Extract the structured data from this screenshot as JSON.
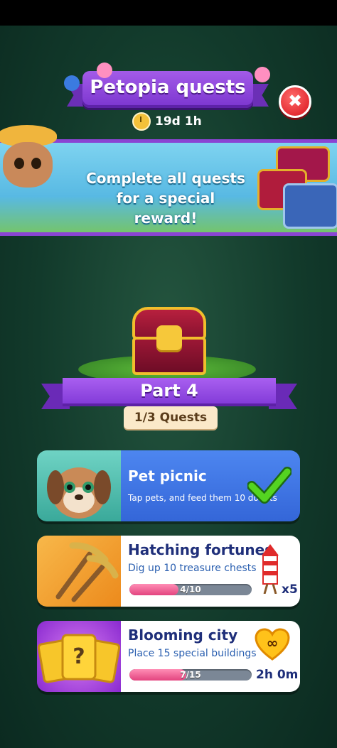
{
  "header": {
    "title": "Petopia quests",
    "timer": "19d 1h",
    "close_label": "✖"
  },
  "banner": {
    "text": "Complete all quests for a special reward!"
  },
  "part": {
    "label": "Part 4",
    "quest_count": "1/3 Quests"
  },
  "quests": [
    {
      "title": "Pet picnic",
      "description": "Tap pets, and feed them 10 donuts",
      "completed": true
    },
    {
      "title": "Hatching fortunes",
      "description": "Dig up 10 treasure chests",
      "progress_text": "4/10",
      "progress_fraction": 0.4,
      "reward": "x5",
      "reward_icon": "firework-rocket-icon"
    },
    {
      "title": "Blooming city",
      "description": "Place 15 special buildings",
      "progress_text": "7/15",
      "progress_fraction": 0.467,
      "reward": "2h 0m",
      "reward_icon": "infinity-heart-icon"
    }
  ],
  "colors": {
    "ribbon_purple": "#8a44d3",
    "card_blue": "#3e72e0",
    "progress_pink": "#e3447f",
    "close_red": "#d8141c"
  }
}
